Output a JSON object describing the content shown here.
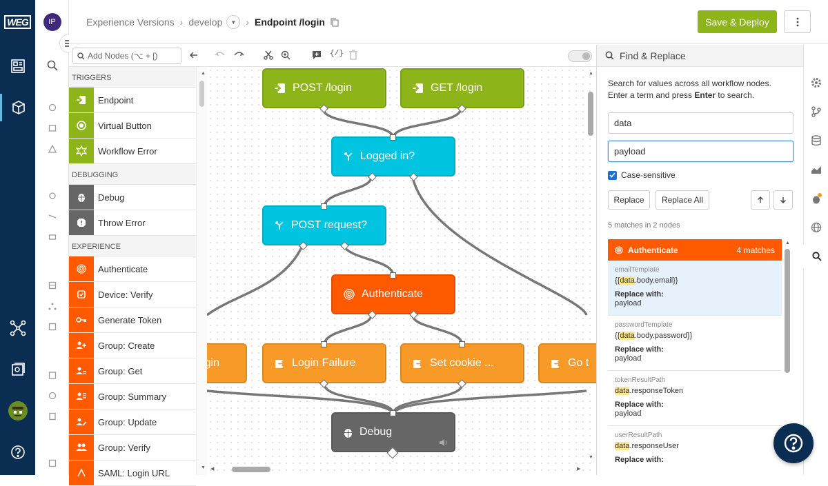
{
  "app": {
    "logo_text": "WEG"
  },
  "topbar": {
    "avatar_initials": "IP",
    "breadcrumb": [
      "Experience Versions",
      "develop",
      "Endpoint /login"
    ],
    "save_label": "Save & Deploy"
  },
  "toolbar": {
    "search_placeholder": "Add Nodes (⌥ + [)"
  },
  "palette": {
    "sections": [
      {
        "title": "TRIGGERS"
      },
      {
        "title": "DEBUGGING"
      },
      {
        "title": "EXPERIENCE"
      }
    ],
    "items": [
      {
        "label": "Endpoint",
        "color": "#8db51a",
        "icon": "endpoint-icon"
      },
      {
        "label": "Virtual Button",
        "color": "#8db51a",
        "icon": "virtual-button-icon"
      },
      {
        "label": "Workflow Error",
        "color": "#8db51a",
        "icon": "workflow-error-icon"
      },
      {
        "label": "Debug",
        "color": "#666666",
        "icon": "debug-icon"
      },
      {
        "label": "Throw Error",
        "color": "#666666",
        "icon": "throw-error-icon"
      },
      {
        "label": "Authenticate",
        "color": "#ff5a00",
        "icon": "fingerprint-icon"
      },
      {
        "label": "Device: Verify",
        "color": "#ff5a00",
        "icon": "device-verify-icon"
      },
      {
        "label": "Generate Token",
        "color": "#ff5a00",
        "icon": "key-icon"
      },
      {
        "label": "Group: Create",
        "color": "#ff5a00",
        "icon": "group-create-icon"
      },
      {
        "label": "Group: Get",
        "color": "#ff5a00",
        "icon": "group-get-icon"
      },
      {
        "label": "Group: Summary",
        "color": "#ff5a00",
        "icon": "group-summary-icon"
      },
      {
        "label": "Group: Update",
        "color": "#ff5a00",
        "icon": "group-update-icon"
      },
      {
        "label": "Group: Verify",
        "color": "#ff5a00",
        "icon": "group-verify-icon"
      },
      {
        "label": "SAML: Login URL",
        "color": "#ff5a00",
        "icon": "saml-icon"
      }
    ]
  },
  "canvas": {
    "nodes": {
      "post_login": "POST /login",
      "get_login": "GET /login",
      "logged_in": "Logged in?",
      "post_request": "POST request?",
      "authenticate": "Authenticate",
      "login_left": "gin",
      "login_failure": "Login Failure",
      "set_cookie": "Set cookie ...",
      "go": "Go t",
      "debug": "Debug"
    },
    "colors": {
      "trigger": "#8db51a",
      "conditional": "#00c4e0",
      "experience": "#ff5a00",
      "output": "#f89a28",
      "debug": "#666666"
    }
  },
  "find_replace": {
    "title": "Find & Replace",
    "description_1": "Search for values across all workflow nodes.",
    "description_2_a": "Enter a term and press ",
    "description_2_b": "Enter",
    "description_2_c": " to search.",
    "find_value": "data",
    "replace_value": "payload",
    "case_sensitive_label": "Case-sensitive",
    "replace_label": "Replace",
    "replace_all_label": "Replace All",
    "summary": "5 matches in 2 nodes",
    "group_title": "Authenticate",
    "group_count": "4 matches",
    "matches": [
      {
        "key": "emailTemplate",
        "pre": "{{",
        "hl": "data",
        "post": ".body.email}}",
        "rw": "Replace with:",
        "rv": "payload"
      },
      {
        "key": "passwordTemplate",
        "pre": "{{",
        "hl": "data",
        "post": ".body.password}}",
        "rw": "Replace with:",
        "rv": "payload"
      },
      {
        "key": "tokenResultPath",
        "pre": "",
        "hl": "data",
        "post": ".responseToken",
        "rw": "Replace with:",
        "rv": "payload"
      },
      {
        "key": "userResultPath",
        "pre": "",
        "hl": "data",
        "post": ".responseUser",
        "rw": "Replace with:",
        "rv": ""
      }
    ]
  }
}
